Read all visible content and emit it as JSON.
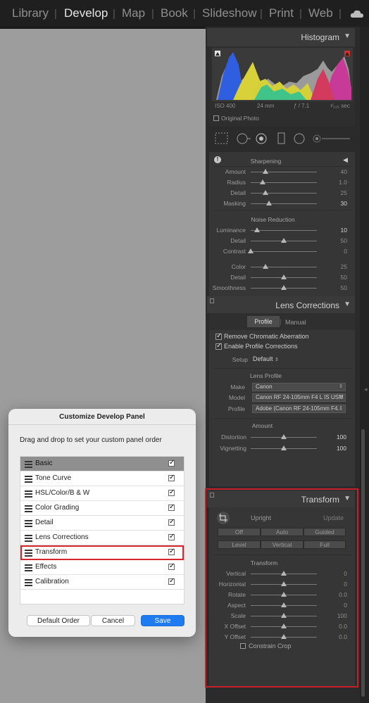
{
  "modules": {
    "items": [
      "Library",
      "Develop",
      "Map",
      "Book",
      "Slideshow",
      "Print",
      "Web"
    ],
    "active": "Develop"
  },
  "histogram": {
    "title": "Histogram",
    "iso": "ISO 400",
    "focal": "24 mm",
    "aperture": "ƒ / 7.1",
    "shutter": "¹⁄₁₂₅ sec",
    "original_photo_label": "Original Photo"
  },
  "detail": {
    "sharpening_title": "Sharpening",
    "sharpening": [
      {
        "label": "Amount",
        "value": "40",
        "pos": 0.22
      },
      {
        "label": "Radius",
        "value": "1.0",
        "pos": 0.18
      },
      {
        "label": "Detail",
        "value": "25",
        "pos": 0.22
      },
      {
        "label": "Masking",
        "value": "30",
        "pos": 0.28,
        "hi": true
      }
    ],
    "noise_title": "Noise Reduction",
    "noise_luma": [
      {
        "label": "Luminance",
        "value": "10",
        "pos": 0.1,
        "hi": true
      },
      {
        "label": "Detail",
        "value": "50",
        "pos": 0.5
      },
      {
        "label": "Contrast",
        "value": "0",
        "pos": 0.0
      }
    ],
    "noise_color": [
      {
        "label": "Color",
        "value": "25",
        "pos": 0.22
      },
      {
        "label": "Detail",
        "value": "50",
        "pos": 0.5
      },
      {
        "label": "Smoothness",
        "value": "50",
        "pos": 0.5
      }
    ]
  },
  "lens": {
    "title": "Lens Corrections",
    "tab_profile": "Profile",
    "tab_manual": "Manual",
    "remove_ca": "Remove Chromatic Aberration",
    "enable_profile": "Enable Profile Corrections",
    "setup_label": "Setup",
    "setup_value": "Default",
    "lens_profile_title": "Lens Profile",
    "make_label": "Make",
    "make_value": "Canon",
    "model_label": "Model",
    "model_value": "Canon RF 24-105mm F4 L IS USM",
    "profile_label": "Profile",
    "profile_value": "Adobe (Canon RF 24-105mm F4...",
    "amount_title": "Amount",
    "distortion_label": "Distortion",
    "distortion_value": "100",
    "vignetting_label": "Vignetting",
    "vignetting_value": "100"
  },
  "transform": {
    "title": "Transform",
    "upright_label": "Upright",
    "update_label": "Update",
    "buttons_row1": [
      "Off",
      "Auto",
      "Guided"
    ],
    "buttons_row2": [
      "Level",
      "Vertical",
      "Full"
    ],
    "sub_title": "Transform",
    "sliders": [
      {
        "label": "Vertical",
        "value": "0"
      },
      {
        "label": "Horizontal",
        "value": "0"
      },
      {
        "label": "Rotate",
        "value": "0.0"
      },
      {
        "label": "Aspect",
        "value": "0"
      },
      {
        "label": "Scale",
        "value": "100"
      },
      {
        "label": "X Offset",
        "value": "0.0"
      },
      {
        "label": "Y Offset",
        "value": "0.0"
      }
    ],
    "constrain_crop": "Constrain Crop"
  },
  "dialog": {
    "title": "Customize Develop Panel",
    "instruction": "Drag and drop to set your custom panel order",
    "items": [
      "Basic",
      "Tone Curve",
      "HSL/Color/B & W",
      "Color Grading",
      "Detail",
      "Lens Corrections",
      "Transform",
      "Effects",
      "Calibration"
    ],
    "default_order_label": "Default Order",
    "cancel_label": "Cancel",
    "save_label": "Save"
  },
  "colors": {
    "accent_blue": "#1e7bf2",
    "highlight_red": "#d6262c"
  }
}
